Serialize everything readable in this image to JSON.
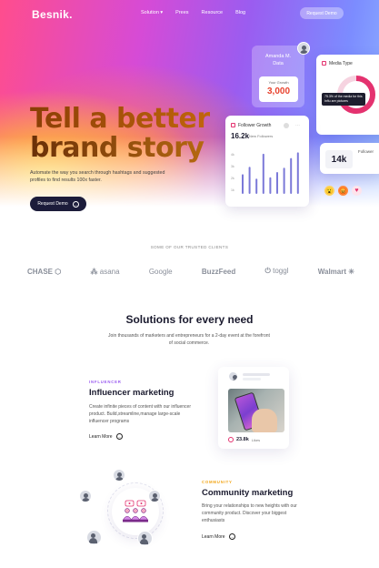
{
  "nav": {
    "logo": "Besnik.",
    "links": [
      "Solution ▾",
      "Prees",
      "Resource",
      "Blog"
    ],
    "cta": "Request Demo"
  },
  "hero": {
    "headline_line1": "Tell a better",
    "headline_line2": "brand story",
    "subtitle": "Automate the way you search through hashtags and suggested profiles to find results 100x faster.",
    "cta": "Request Demo"
  },
  "widgets": {
    "profile_name": "Amanda M.\nData",
    "growth_label": "Your Growth",
    "growth_value": "3,000",
    "media_title": "Media Type",
    "media_tip": "75.3% of the media for this Influ are pictures",
    "follow_title": "Follower Growth",
    "follow_count": "16.2k",
    "follow_note": "New Followers",
    "followers_value": "14k",
    "followers_label": "Follower",
    "chart_axis": [
      "4k",
      "3k",
      "2k",
      "1k"
    ],
    "bars": [
      0.45,
      0.62,
      0.35,
      0.92,
      0.38,
      0.5,
      0.6,
      0.82,
      0.95
    ],
    "accent": "#e4326f",
    "bar_color": "#7b79d8"
  },
  "clients": {
    "title": "SOME OF OUR TRUSTED CLIENTS",
    "logos": [
      "CHASE",
      "asana",
      "Google",
      "BuzzFeed",
      "toggl",
      "Walmart"
    ]
  },
  "solutions": {
    "title": "Solutions for every need",
    "subtitle": "Join thousands of marketers and entrepreneurs for a 2-day event at the forefront of social commerce."
  },
  "influencer": {
    "kicker": "INFLUENCER",
    "title": "Influencer marketing",
    "body": "Create infinite pieces of content with our influencer product. Build,streamline,manage large-scale influencer programs",
    "learn": "Learn More",
    "likes_value": "23.8k",
    "likes_label": "Likes",
    "kicker_color": "#9b5cf0"
  },
  "community": {
    "kicker": "COMMUNITY",
    "title": "Community marketing",
    "body": "Bring your relationships to new heights with our community product. Discover your biggest enthusiasts",
    "learn": "Learn More",
    "kicker_color": "#f2a516"
  }
}
